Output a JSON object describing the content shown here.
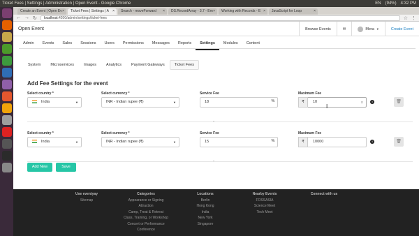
{
  "window": {
    "title": "Ticket Fees | Settings | Administration | Open Event - Google Chrome",
    "tray": [
      "EN",
      "(94%)",
      "4:32 PM"
    ]
  },
  "browser": {
    "tabs": [
      {
        "label": "Create an Event | Open Ev",
        "active": false
      },
      {
        "label": "Ticket Fees | Settings | A",
        "active": true
      },
      {
        "label": "Search - moveForward",
        "active": false
      },
      {
        "label": "DS.RecordArray - 3.7 - Em",
        "active": false
      },
      {
        "label": "Working with Records - E",
        "active": false
      },
      {
        "label": "JavaScript for Loop",
        "active": false
      }
    ],
    "url_host": "localhost",
    "url_path": ":4200/admin/settings/ticket-fees"
  },
  "header": {
    "brand": "Open Event",
    "browse_events": "Browse Events",
    "user": "Mera",
    "create_event": "Create Event"
  },
  "admin_nav": [
    "Admin",
    "Events",
    "Sales",
    "Sessions",
    "Users",
    "Permissions",
    "Messages",
    "Reports",
    "Settings",
    "Modules",
    "Content"
  ],
  "admin_nav_active": "Settings",
  "settings_nav": [
    "System",
    "Microservices",
    "Images",
    "Analytics",
    "Payment Gateways",
    "Ticket Fees"
  ],
  "settings_nav_active": "Ticket Fees",
  "heading": "Add Fee Settings for the event",
  "labels": {
    "country": "Select country *",
    "currency": "Select currency *",
    "service_fee": "Service Fee",
    "maximum_fee": "Maximum Fee"
  },
  "fee_rows": [
    {
      "country": "India",
      "currency": "INR - Indian rupee (₹)",
      "service_fee": "18",
      "percent": "%",
      "currency_symbol": "₹",
      "maximum_fee": "10"
    },
    {
      "country": "India",
      "currency": "INR - Indian rupee (₹)",
      "service_fee": "15",
      "percent": "%",
      "currency_symbol": "₹",
      "maximum_fee": "10000"
    }
  ],
  "buttons": {
    "add_new": "Add New",
    "save": "Save"
  },
  "footer": {
    "cols": [
      {
        "heading": "Use eventyay",
        "items": [
          "Sitemap"
        ]
      },
      {
        "heading": "Categories",
        "items": [
          "Appearance or Signing",
          "Attraction",
          "Camp, Treat & Retreat",
          "Class, Training, or Workshop",
          "Concert or Performance",
          "Conference"
        ]
      },
      {
        "heading": "Locations",
        "items": [
          "Berlin",
          "Hong Kong",
          "India",
          "New York",
          "Singapore"
        ]
      },
      {
        "heading": "Nearby Events",
        "items": [
          "FOSSASIA",
          "Science Meet",
          "Tech Meet"
        ]
      },
      {
        "heading": "Connect with us",
        "items": []
      }
    ]
  }
}
